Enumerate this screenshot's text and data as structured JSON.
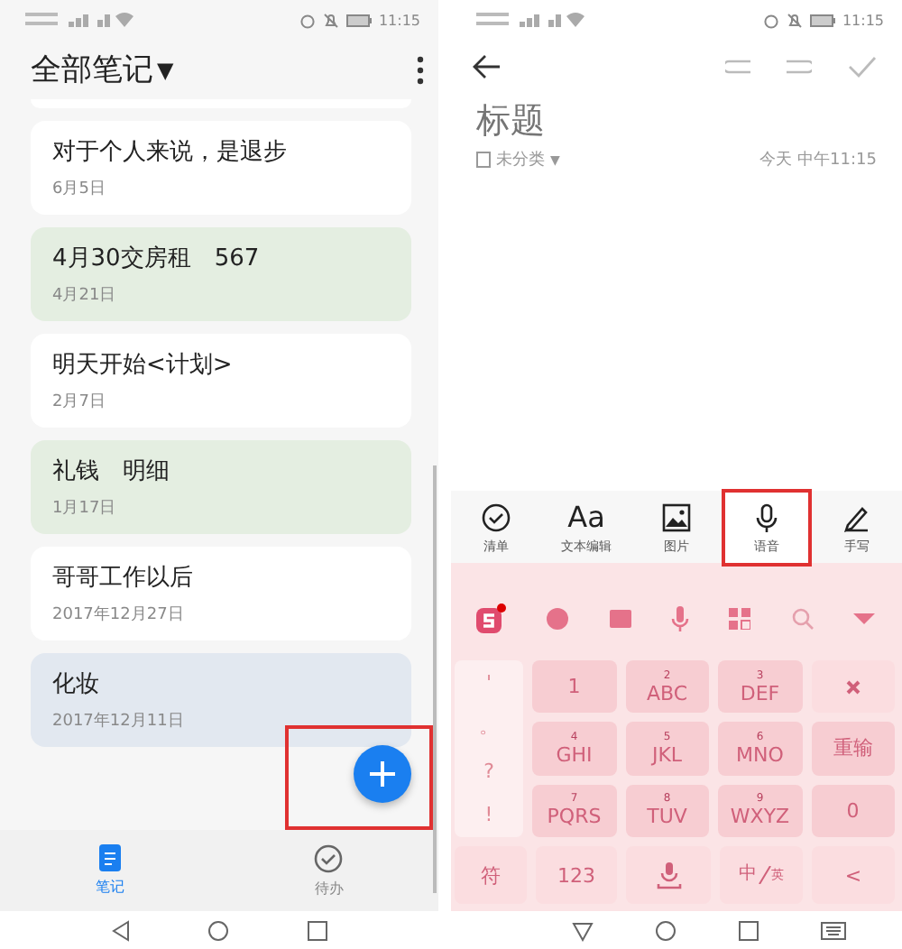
{
  "left_screen": {
    "status_bar": {
      "time": "11:15"
    },
    "header": {
      "title": "全部笔记",
      "dropdown": "▼"
    },
    "notes": [
      {
        "title": "对于个人来说，是退步",
        "date": "6月5日",
        "color": "#ffffff"
      },
      {
        "title": "4月30交房租　567",
        "date": "4月21日",
        "color": "#e4eee1"
      },
      {
        "title": "明天开始<计划>",
        "date": "2月7日",
        "color": "#ffffff"
      },
      {
        "title": "礼钱　明细",
        "date": "1月17日",
        "color": "#e4eee1"
      },
      {
        "title": "哥哥工作以后",
        "date": "2017年12月27日",
        "color": "#ffffff"
      },
      {
        "title": "化妆",
        "date": "2017年12月11日",
        "color": "#e2e8f0"
      }
    ],
    "bottom_tabs": [
      {
        "label": "笔记",
        "kind": "notes",
        "selected": true
      },
      {
        "label": "待办",
        "kind": "todo",
        "selected": false
      }
    ]
  },
  "right_screen": {
    "status_bar": {
      "time": "11:15"
    },
    "title_placeholder": "标题",
    "category": "未分类",
    "category_dropdown": "▼",
    "timestamp": "今天 中午11:15",
    "format_tools": [
      {
        "label": "清单",
        "kind": "checklist",
        "highlighted": false
      },
      {
        "label": "文本编辑",
        "kind": "text",
        "glyph": "Aa",
        "highlighted": false
      },
      {
        "label": "图片",
        "kind": "image",
        "highlighted": false
      },
      {
        "label": "语音",
        "kind": "voice",
        "highlighted": true
      },
      {
        "label": "手写",
        "kind": "handwriting",
        "highlighted": false
      }
    ],
    "keyboard": {
      "side_keys": [
        "'",
        "。",
        "?",
        "!"
      ],
      "keys": [
        {
          "label": "1",
          "kind": "text"
        },
        {
          "label": "ABC",
          "hint": "2",
          "kind": "text"
        },
        {
          "label": "DEF",
          "hint": "3",
          "kind": "text"
        },
        {
          "kind": "delete"
        },
        {
          "label": "GHI",
          "hint": "4",
          "kind": "text"
        },
        {
          "label": "JKL",
          "hint": "5",
          "kind": "text"
        },
        {
          "label": "MNO",
          "hint": "6",
          "kind": "text"
        },
        {
          "label": "重输",
          "kind": "text"
        },
        {
          "label": "PQRS",
          "hint": "7",
          "kind": "text"
        },
        {
          "label": "TUV",
          "hint": "8",
          "kind": "text"
        },
        {
          "label": "WXYZ",
          "hint": "9",
          "kind": "text"
        },
        {
          "label": "0",
          "kind": "text"
        }
      ],
      "bottom_row": [
        {
          "label": "符",
          "kind": "text"
        },
        {
          "label": "123",
          "kind": "text"
        },
        {
          "kind": "space"
        },
        {
          "label": "中",
          "sub": "英",
          "kind": "lang"
        },
        {
          "label": "<",
          "kind": "text"
        }
      ]
    }
  }
}
